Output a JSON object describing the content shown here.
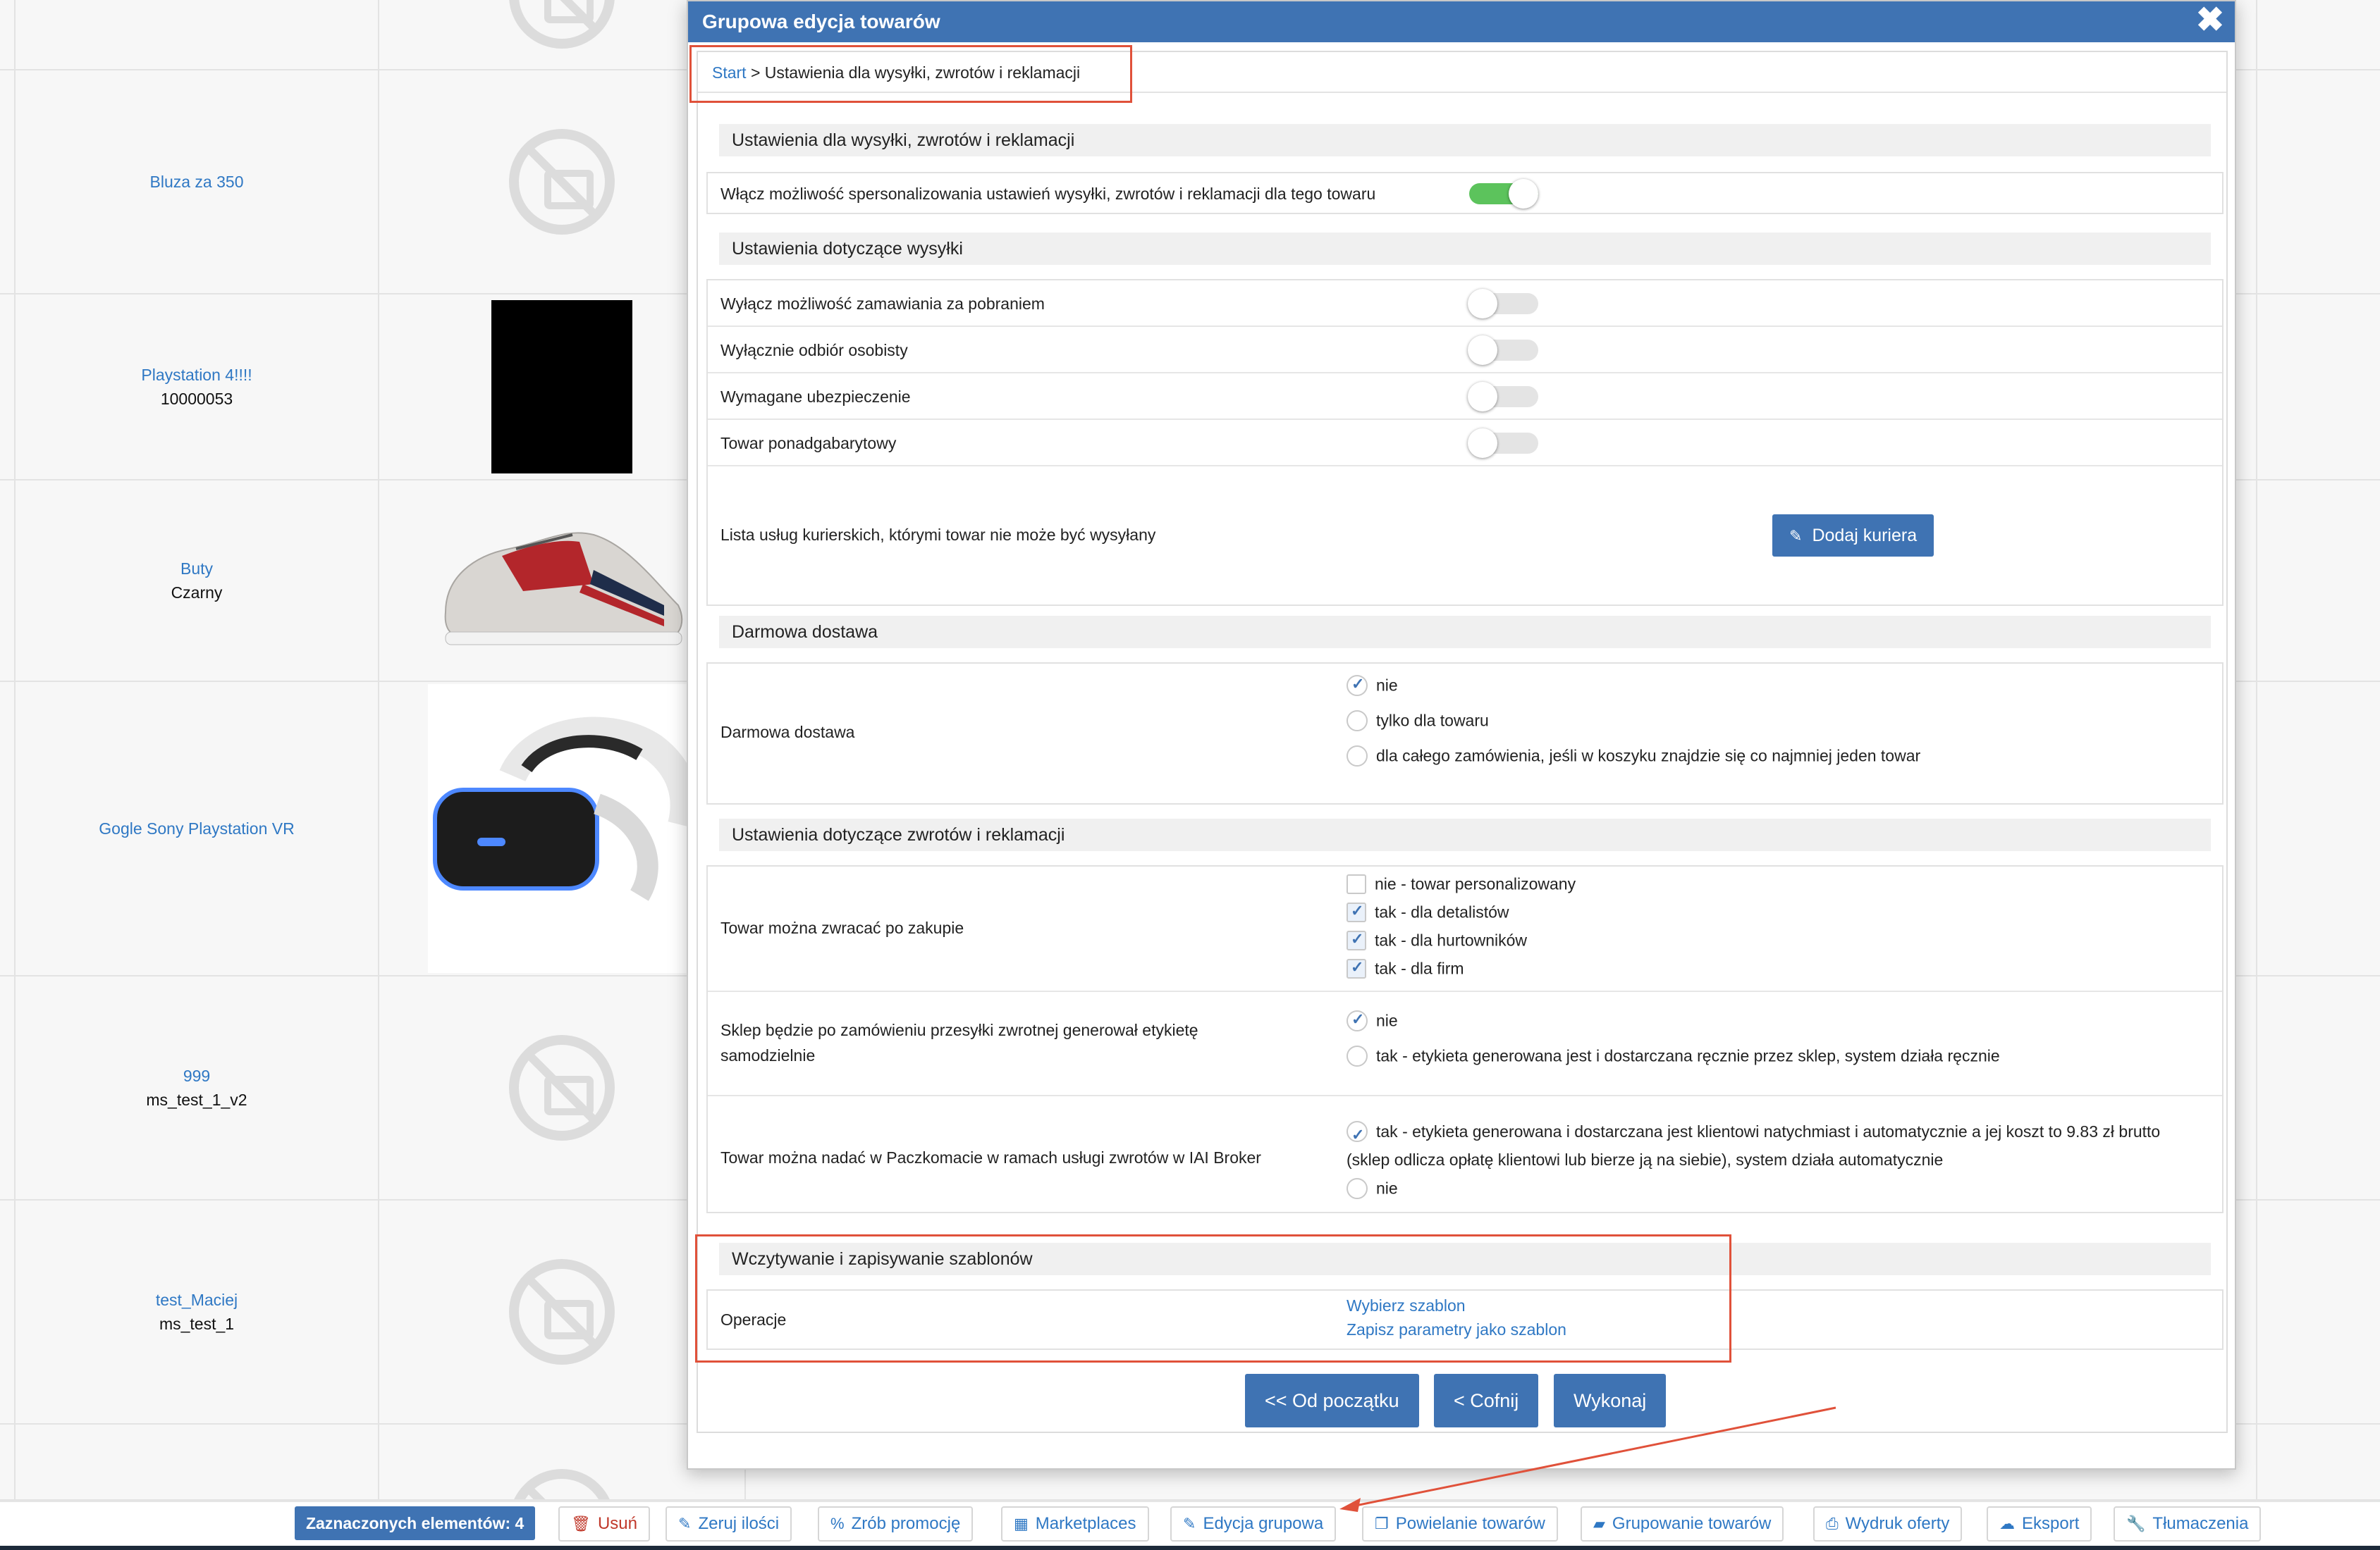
{
  "products": [
    {
      "name": "",
      "sub": "",
      "image": "no-image"
    },
    {
      "name": "Bluza za 350",
      "sub": "",
      "image": "no-image"
    },
    {
      "name": "Playstation 4!!!!",
      "sub": "10000053",
      "image": "black"
    },
    {
      "name": "Buty",
      "sub": "Czarny",
      "image": "shoe"
    },
    {
      "name": "Gogle Sony Playstation VR",
      "sub": "",
      "image": "vr"
    },
    {
      "name": "999",
      "sub": "ms_test_1_v2",
      "image": "no-image"
    },
    {
      "name": "test_Maciej",
      "sub": "ms_test_1",
      "image": "no-image"
    },
    {
      "name": "",
      "sub": "",
      "image": "no-image"
    }
  ],
  "bottom_bar": {
    "selected_count": "Zaznaczonych elementów: 4",
    "actions": {
      "delete": "Usuń",
      "zero_qty": "Zeruj ilości",
      "promotion": "Zrób promocję",
      "marketplaces": "Marketplaces",
      "bulk_edit": "Edycja grupowa",
      "duplicate": "Powielanie towarów",
      "grouping": "Grupowanie towarów",
      "print_offer": "Wydruk oferty",
      "export": "Eksport",
      "translations": "Tłumaczenia"
    }
  },
  "modal": {
    "title": "Grupowa edycja towarów",
    "close": "✖",
    "breadcrumb": {
      "start": "Start",
      "separator": " > ",
      "current": "Ustawienia dla wysyłki, zwrotów i reklamacji"
    },
    "sections": {
      "main": "Ustawienia dla wysyłki, zwrotów i reklamacji",
      "shipping": "Ustawienia dotyczące wysyłki",
      "free_delivery": "Darmowa dostawa",
      "returns": "Ustawienia dotyczące zwrotów i reklamacji",
      "templates": "Wczytywanie i zapisywanie szablonów"
    },
    "personalize": {
      "label": "Włącz możliwość spersonalizowania ustawień wysyłki, zwrotów i reklamacji dla tego towaru",
      "enabled": true
    },
    "shipping_rows": [
      {
        "label": "Wyłącz możliwość zamawiania za pobraniem",
        "enabled": false
      },
      {
        "label": "Wyłącznie odbiór osobisty",
        "enabled": false
      },
      {
        "label": "Wymagane ubezpieczenie",
        "enabled": false
      },
      {
        "label": "Towar ponadgabarytowy",
        "enabled": false
      }
    ],
    "couriers": {
      "label": "Lista usług kurierskich, którymi towar nie może być wysyłany",
      "button": "Dodaj kuriera"
    },
    "free_delivery": {
      "label": "Darmowa dostawa",
      "options": [
        "nie",
        "tylko dla towaru",
        "dla całego zamówienia, jeśli w koszyku znajdzie się co najmniej jeden towar"
      ],
      "selected": 0
    },
    "returns_after_purchase": {
      "label": "Towar można zwracać po zakupie",
      "options": [
        {
          "label": "nie - towar personalizowany",
          "checked": false
        },
        {
          "label": "tak - dla detalistów",
          "checked": true
        },
        {
          "label": "tak - dla hurtowników",
          "checked": true
        },
        {
          "label": "tak - dla firm",
          "checked": true
        }
      ]
    },
    "return_label": {
      "label_line1": "Sklep będzie po zamówieniu przesyłki zwrotnej generował etykietę",
      "label_line2": "samodzielnie",
      "options": [
        "nie",
        "tak - etykieta generowana jest i dostarczana ręcznie przez sklep, system działa ręcznie"
      ],
      "selected": 0
    },
    "paczkomat": {
      "label": "Towar można nadać w Paczkomacie w ramach usługi zwrotów w IAI Broker",
      "option_yes_line1": "tak - etykieta generowana i dostarczana jest klientowi natychmiast i automatycznie a jej koszt to 9.83 zł brutto",
      "option_yes_line2": "(sklep odlicza opłatę klientowi lub bierze ją na siebie), system działa automatycznie",
      "option_no": "nie",
      "selected": 0
    },
    "operations": {
      "label": "Operacje",
      "choose": "Wybierz szablon",
      "save": "Zapisz parametry jako szablon"
    },
    "footer": {
      "back_to_start": "<< Od początku",
      "back": "< Cofnij",
      "execute": "Wykonaj"
    }
  },
  "colors": {
    "primary": "#3f73b3",
    "toggle_on": "#5cc35c",
    "annotation": "#e0513a",
    "link": "#2f78c4"
  }
}
